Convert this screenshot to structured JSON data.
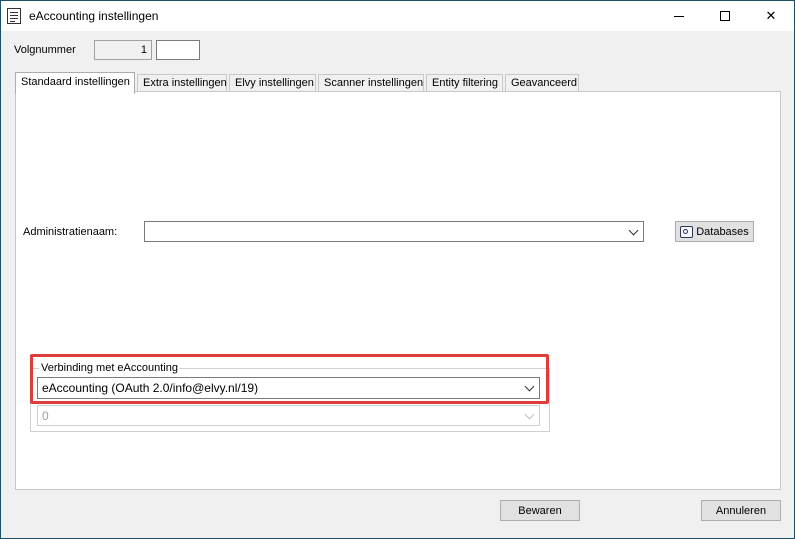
{
  "window": {
    "title": "eAccounting instellingen"
  },
  "header": {
    "volgnummer_label": "Volgnummer",
    "volgnummer_value": "1",
    "extra_value": ""
  },
  "tabs": [
    {
      "label": "Standaard instellingen",
      "active": true
    },
    {
      "label": "Extra instellingen",
      "active": false
    },
    {
      "label": "Elvy instellingen",
      "active": false
    },
    {
      "label": "Scanner instellingen",
      "active": false
    },
    {
      "label": "Entity filtering",
      "active": false
    },
    {
      "label": "Geavanceerd",
      "active": false
    }
  ],
  "main": {
    "administratie_label": "Administratienaam:",
    "administratie_value": "",
    "databases_button": "Databases",
    "connection_group_title": "Verbinding met eAccounting",
    "connection_value": "eAccounting (OAuth 2.0/info@elvy.nl/19)",
    "secondary_value": "0"
  },
  "footer": {
    "save_button": "Bewaren",
    "cancel_button": "Annuleren"
  },
  "colors": {
    "highlight": "#e03c3c",
    "border": "#1b4f63"
  }
}
